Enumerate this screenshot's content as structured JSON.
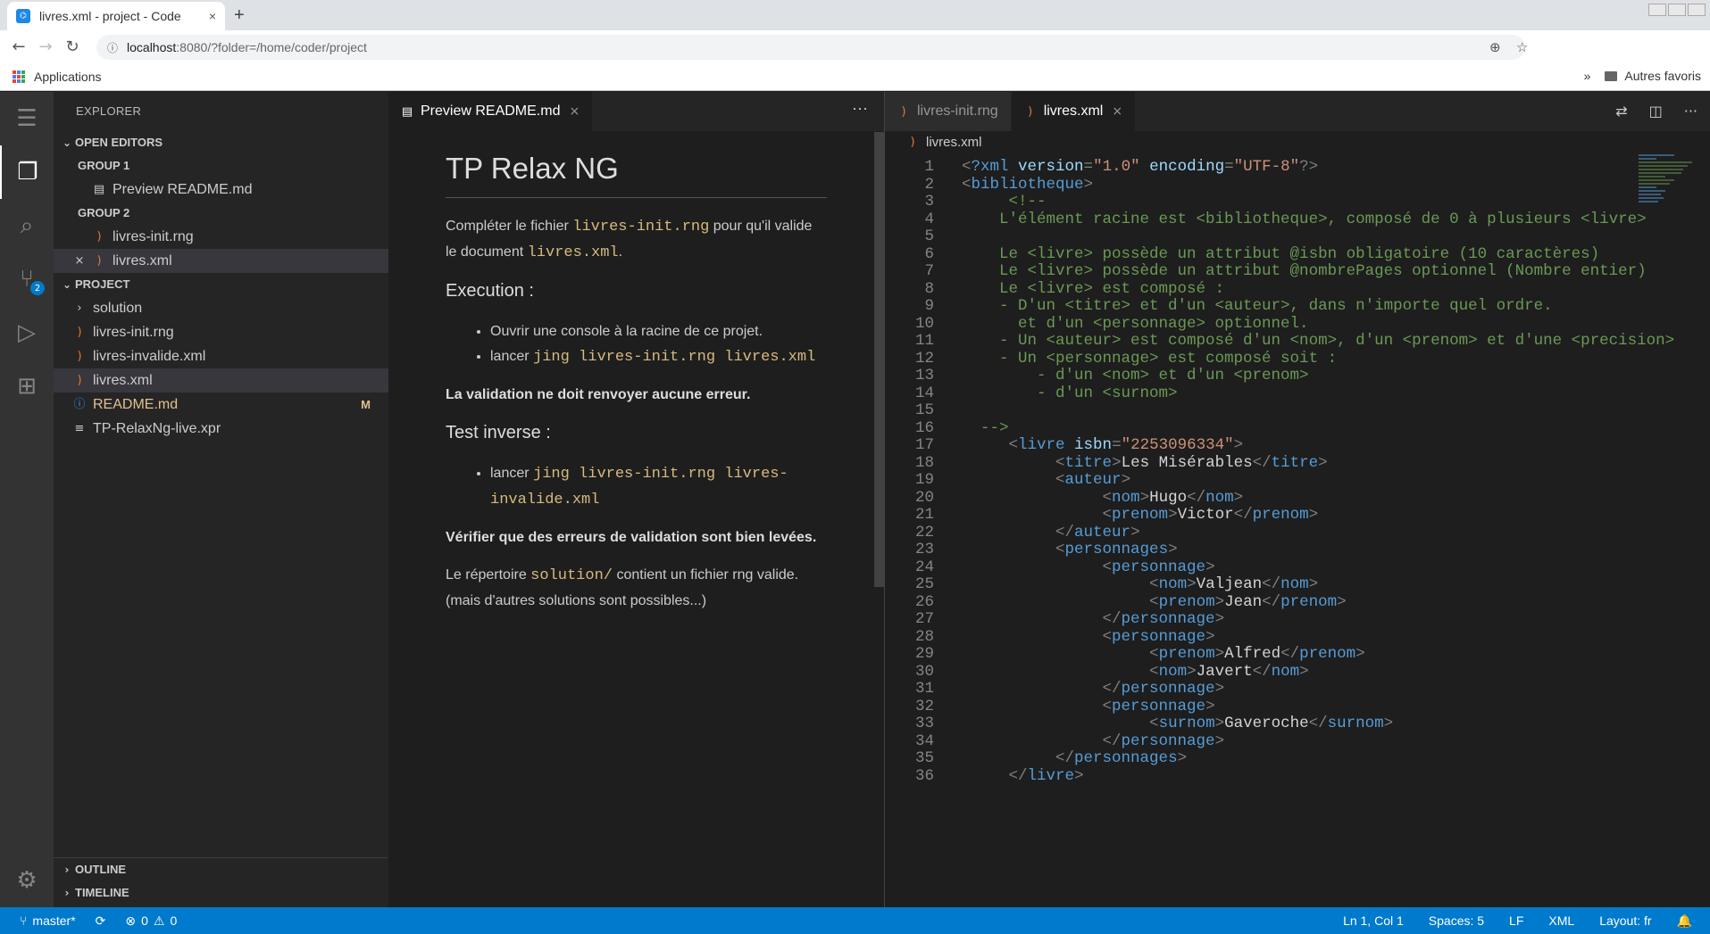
{
  "browser": {
    "tab_title": "livres.xml - project - Code",
    "tab_close": "×",
    "new_tab": "+",
    "url_host": "localhost",
    "url_rest": ":8080/?folder=/home/coder/project",
    "bookmark_apps": "Applications",
    "bookmark_more": "»",
    "bookmark_other": "Autres favoris"
  },
  "sidebar": {
    "title": "EXPLORER",
    "open_editors": "OPEN EDITORS",
    "group1": "GROUP 1",
    "group1_items": [
      "Preview README.md"
    ],
    "group2": "GROUP 2",
    "group2_items": [
      "livres-init.rng",
      "livres.xml"
    ],
    "project": "PROJECT",
    "project_items": [
      "solution",
      "livres-init.rng",
      "livres-invalide.xml",
      "livres.xml",
      "README.md",
      "TP-RelaxNg-live.xpr"
    ],
    "readme_badge": "M",
    "outline": "OUTLINE",
    "timeline": "TIMELINE"
  },
  "activity": {
    "scm_badge": "2"
  },
  "editor1": {
    "tab": "Preview README.md",
    "h1": "TP Relax NG",
    "p1_a": "Compléter le fichier ",
    "p1_code1": "livres-init.rng",
    "p1_b": " pour qu'il valide le document ",
    "p1_code2": "livres.xml",
    "p1_c": ".",
    "h_exec": "Execution :",
    "li1": "Ouvrir une console à la racine de ce projet.",
    "li2_a": "lancer ",
    "li2_code": "jing livres-init.rng livres.xml",
    "bold1": "La validation ne doit renvoyer aucune erreur.",
    "h_test": "Test inverse :",
    "li3_a": "lancer ",
    "li3_code": "jing livres-init.rng livres-invalide.xml",
    "bold2": "Vérifier que des erreurs de validation sont bien levées.",
    "p_last_a": "Le répertoire ",
    "p_last_code": "solution/",
    "p_last_b": " contient un fichier rng valide. (mais d'autres solutions sont possibles...)"
  },
  "editor2": {
    "tab1": "livres-init.rng",
    "tab2": "livres.xml",
    "breadcrumb": "livres.xml",
    "lines": [
      [
        [
          "p",
          "<"
        ],
        [
          "t",
          "?xml "
        ],
        [
          "a",
          "version"
        ],
        [
          "p",
          "="
        ],
        [
          "s",
          "\"1.0\""
        ],
        [
          "a",
          " encoding"
        ],
        [
          "p",
          "="
        ],
        [
          "s",
          "\"UTF-8\""
        ],
        [
          "p",
          "?>"
        ]
      ],
      [
        [
          "p",
          "<"
        ],
        [
          "t",
          "bibliotheque"
        ],
        [
          "p",
          ">"
        ]
      ],
      [
        [
          "c",
          "     <!--"
        ]
      ],
      [
        [
          "c",
          "    L'élément racine est <bibliotheque>, composé de 0 à plusieurs <livre>"
        ]
      ],
      [
        [
          "c",
          ""
        ]
      ],
      [
        [
          "c",
          "    Le <livre> possède un attribut @isbn obligatoire (10 caractères)"
        ]
      ],
      [
        [
          "c",
          "    Le <livre> possède un attribut @nombrePages optionnel (Nombre entier)"
        ]
      ],
      [
        [
          "c",
          "    Le <livre> est composé :"
        ]
      ],
      [
        [
          "c",
          "    - D'un <titre> et d'un <auteur>, dans n'importe quel ordre."
        ]
      ],
      [
        [
          "c",
          "      et d'un <personnage> optionnel."
        ]
      ],
      [
        [
          "c",
          "    - Un <auteur> est composé d'un <nom>, d'un <prenom> et d'une <precision>"
        ]
      ],
      [
        [
          "c",
          "    - Un <personnage> est composé soit :"
        ]
      ],
      [
        [
          "c",
          "        - d'un <nom> et d'un <prenom>"
        ]
      ],
      [
        [
          "c",
          "        - d'un <surnom>"
        ]
      ],
      [
        [
          "c",
          ""
        ]
      ],
      [
        [
          "c",
          "  -->"
        ]
      ],
      [
        [
          "d",
          "     "
        ],
        [
          "p",
          "<"
        ],
        [
          "t",
          "livre"
        ],
        [
          "a",
          " isbn"
        ],
        [
          "p",
          "="
        ],
        [
          "s",
          "\"2253096334\""
        ],
        [
          "p",
          ">"
        ]
      ],
      [
        [
          "d",
          "          "
        ],
        [
          "p",
          "<"
        ],
        [
          "t",
          "titre"
        ],
        [
          "p",
          ">"
        ],
        [
          "d",
          "Les Misérables"
        ],
        [
          "p",
          "</"
        ],
        [
          "t",
          "titre"
        ],
        [
          "p",
          ">"
        ]
      ],
      [
        [
          "d",
          "          "
        ],
        [
          "p",
          "<"
        ],
        [
          "t",
          "auteur"
        ],
        [
          "p",
          ">"
        ]
      ],
      [
        [
          "d",
          "               "
        ],
        [
          "p",
          "<"
        ],
        [
          "t",
          "nom"
        ],
        [
          "p",
          ">"
        ],
        [
          "d",
          "Hugo"
        ],
        [
          "p",
          "</"
        ],
        [
          "t",
          "nom"
        ],
        [
          "p",
          ">"
        ]
      ],
      [
        [
          "d",
          "               "
        ],
        [
          "p",
          "<"
        ],
        [
          "t",
          "prenom"
        ],
        [
          "p",
          ">"
        ],
        [
          "d",
          "Victor"
        ],
        [
          "p",
          "</"
        ],
        [
          "t",
          "prenom"
        ],
        [
          "p",
          ">"
        ]
      ],
      [
        [
          "d",
          "          "
        ],
        [
          "p",
          "</"
        ],
        [
          "t",
          "auteur"
        ],
        [
          "p",
          ">"
        ]
      ],
      [
        [
          "d",
          "          "
        ],
        [
          "p",
          "<"
        ],
        [
          "t",
          "personnages"
        ],
        [
          "p",
          ">"
        ]
      ],
      [
        [
          "d",
          "               "
        ],
        [
          "p",
          "<"
        ],
        [
          "t",
          "personnage"
        ],
        [
          "p",
          ">"
        ]
      ],
      [
        [
          "d",
          "                    "
        ],
        [
          "p",
          "<"
        ],
        [
          "t",
          "nom"
        ],
        [
          "p",
          ">"
        ],
        [
          "d",
          "Valjean"
        ],
        [
          "p",
          "</"
        ],
        [
          "t",
          "nom"
        ],
        [
          "p",
          ">"
        ]
      ],
      [
        [
          "d",
          "                    "
        ],
        [
          "p",
          "<"
        ],
        [
          "t",
          "prenom"
        ],
        [
          "p",
          ">"
        ],
        [
          "d",
          "Jean"
        ],
        [
          "p",
          "</"
        ],
        [
          "t",
          "prenom"
        ],
        [
          "p",
          ">"
        ]
      ],
      [
        [
          "d",
          "               "
        ],
        [
          "p",
          "</"
        ],
        [
          "t",
          "personnage"
        ],
        [
          "p",
          ">"
        ]
      ],
      [
        [
          "d",
          "               "
        ],
        [
          "p",
          "<"
        ],
        [
          "t",
          "personnage"
        ],
        [
          "p",
          ">"
        ]
      ],
      [
        [
          "d",
          "                    "
        ],
        [
          "p",
          "<"
        ],
        [
          "t",
          "prenom"
        ],
        [
          "p",
          ">"
        ],
        [
          "d",
          "Alfred"
        ],
        [
          "p",
          "</"
        ],
        [
          "t",
          "prenom"
        ],
        [
          "p",
          ">"
        ]
      ],
      [
        [
          "d",
          "                    "
        ],
        [
          "p",
          "<"
        ],
        [
          "t",
          "nom"
        ],
        [
          "p",
          ">"
        ],
        [
          "d",
          "Javert"
        ],
        [
          "p",
          "</"
        ],
        [
          "t",
          "nom"
        ],
        [
          "p",
          ">"
        ]
      ],
      [
        [
          "d",
          "               "
        ],
        [
          "p",
          "</"
        ],
        [
          "t",
          "personnage"
        ],
        [
          "p",
          ">"
        ]
      ],
      [
        [
          "d",
          "               "
        ],
        [
          "p",
          "<"
        ],
        [
          "t",
          "personnage"
        ],
        [
          "p",
          ">"
        ]
      ],
      [
        [
          "d",
          "                    "
        ],
        [
          "p",
          "<"
        ],
        [
          "t",
          "surnom"
        ],
        [
          "p",
          ">"
        ],
        [
          "d",
          "Gaveroche"
        ],
        [
          "p",
          "</"
        ],
        [
          "t",
          "surnom"
        ],
        [
          "p",
          ">"
        ]
      ],
      [
        [
          "d",
          "               "
        ],
        [
          "p",
          "</"
        ],
        [
          "t",
          "personnage"
        ],
        [
          "p",
          ">"
        ]
      ],
      [
        [
          "d",
          "          "
        ],
        [
          "p",
          "</"
        ],
        [
          "t",
          "personnages"
        ],
        [
          "p",
          ">"
        ]
      ],
      [
        [
          "d",
          "     "
        ],
        [
          "p",
          "</"
        ],
        [
          "t",
          "livre"
        ],
        [
          "p",
          ">"
        ]
      ]
    ]
  },
  "status": {
    "branch": "master*",
    "errors": "0",
    "warnings": "0",
    "position": "Ln 1, Col 1",
    "spaces": "Spaces: 5",
    "eol": "LF",
    "lang": "XML",
    "layout": "Layout: fr"
  }
}
